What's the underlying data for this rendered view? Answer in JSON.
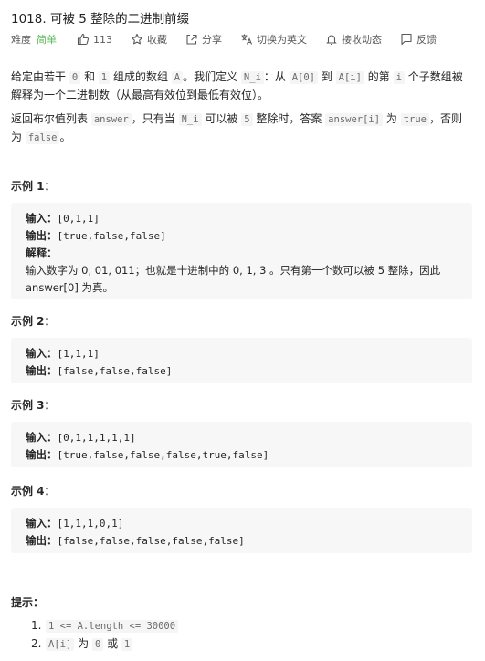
{
  "problem": {
    "title": "1018. 可被 5 整除的二进制前缀",
    "difficulty_label": "难度",
    "difficulty": "简单",
    "likes": "113",
    "actions": {
      "favorite": "收藏",
      "share": "分享",
      "switch_lang": "切换为英文",
      "subscribe": "接收动态",
      "feedback": "反馈"
    }
  },
  "description": {
    "p1": {
      "t1": "给定由若干 ",
      "c1": "0",
      "t2": " 和 ",
      "c2": "1",
      "t3": " 组成的数组 ",
      "c3": "A",
      "t4": "。我们定义 ",
      "c4": "N_i",
      "t5": "：从 ",
      "c5": "A[0]",
      "t6": " 到 ",
      "c6": "A[i]",
      "t7": " 的第 ",
      "c7": "i",
      "t8": " 个子数组被解释为一个二进制数（从最高有效位到最低有效位）。"
    },
    "p2": {
      "t1": "返回布尔值列表 ",
      "c1": "answer",
      "t2": "，只有当 ",
      "c2": "N_i",
      "t3": " 可以被 ",
      "c3": "5",
      "t4": " 整除时，答案 ",
      "c4": "answer[i]",
      "t5": " 为 ",
      "c5": "true",
      "t6": "，否则为 ",
      "c6": "false",
      "t7": "。"
    }
  },
  "labels": {
    "input": "输入：",
    "output": "输出：",
    "explanation": "解释："
  },
  "examples": [
    {
      "title": "示例 1：",
      "input": "[0,1,1]",
      "output": "[true,false,false]",
      "explanation": "输入数字为 0, 01, 011；也就是十进制中的 0, 1, 3 。只有第一个数可以被 5 整除，因此 answer[0] 为真。"
    },
    {
      "title": "示例 2：",
      "input": "[1,1,1]",
      "output": "[false,false,false]"
    },
    {
      "title": "示例 3：",
      "input": "[0,1,1,1,1,1]",
      "output": "[true,false,false,false,true,false]"
    },
    {
      "title": "示例 4：",
      "input": "[1,1,1,0,1]",
      "output": "[false,false,false,false,false]"
    }
  ],
  "hints": {
    "title": "提示：",
    "items": [
      {
        "num": "1.",
        "code": "1 <= A.length <= 30000"
      },
      {
        "num": "2.",
        "code1": "A[i]",
        "t1": " 为 ",
        "code2": "0",
        "t2": " 或 ",
        "code3": "1"
      }
    ]
  },
  "icons": [
    "thumbs-up-icon",
    "star-icon",
    "share-icon",
    "translate-icon",
    "bell-icon",
    "flag-icon"
  ]
}
